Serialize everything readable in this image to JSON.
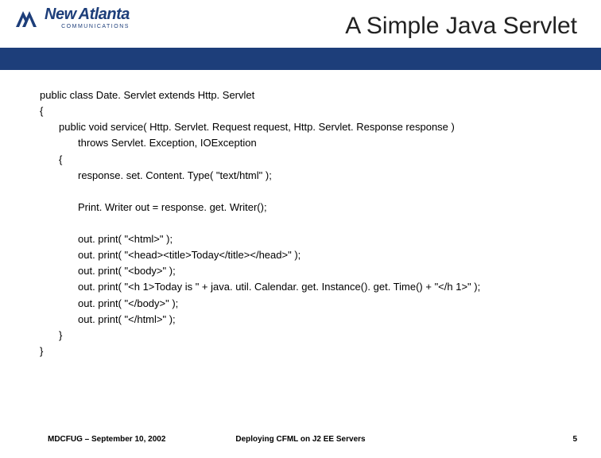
{
  "header": {
    "logo": {
      "brand_new": "New",
      "brand_atlanta": "Atlanta",
      "brand_sub": "COMMUNICATIONS"
    },
    "title": "A Simple Java Servlet"
  },
  "code": {
    "l01": "public class Date. Servlet extends Http. Servlet",
    "l02": "{",
    "l03": "public void service( Http. Servlet. Request request, Http. Servlet. Response response )",
    "l04": "throws Servlet. Exception, IOException",
    "l05": "{",
    "l06": "response. set. Content. Type( \"text/html\" );",
    "l07": "Print. Writer out = response. get. Writer();",
    "l08": "out. print( \"<html>\" );",
    "l09": "out. print( \"<head><title>Today</title></head>\" );",
    "l10": "out. print( \"<body>\" );",
    "l11": "out. print( \"<h 1>Today is \" + java. util. Calendar. get. Instance(). get. Time() + \"</h 1>\" );",
    "l12": "out. print( \"</body>\" );",
    "l13": "out. print( \"</html>\" );",
    "l14": "}",
    "l15": "}"
  },
  "footer": {
    "left": "MDCFUG – September 10, 2002",
    "center": "Deploying CFML on J2 EE Servers",
    "page": "5"
  }
}
